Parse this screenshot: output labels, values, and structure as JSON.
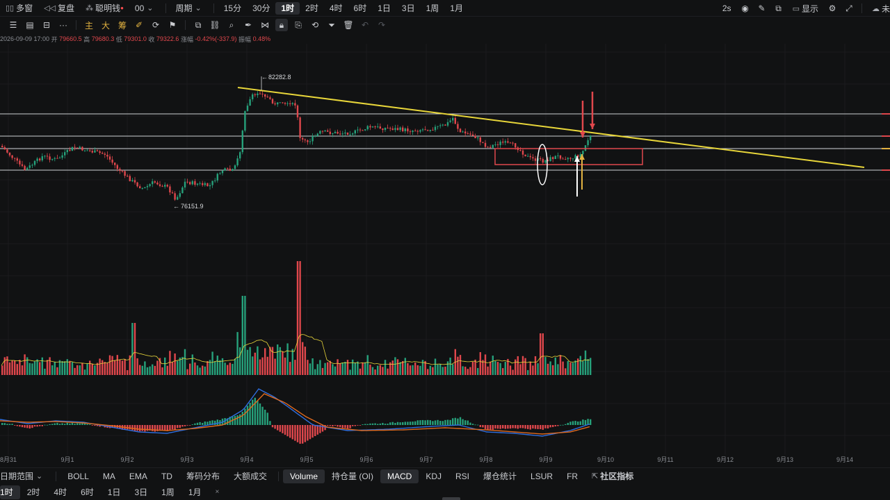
{
  "topbar": {
    "multi_window": "多窗",
    "replay": "复盘",
    "smart_money": "聪明钱",
    "infinity": "00",
    "period": "周期",
    "timeframes": [
      "15分",
      "30分",
      "1时",
      "2时",
      "4时",
      "6时",
      "1日",
      "3日",
      "1周",
      "1月"
    ],
    "active_timeframe": "1时",
    "refresh": "2s",
    "display": "显示",
    "cutoff": "未"
  },
  "drawbar": {
    "main": "主",
    "big": "大",
    "chip": "筹",
    "more": "···"
  },
  "info": {
    "datetime": "2026-09-09 17:00",
    "open_label": "开",
    "open": "79660.5",
    "high_label": "高",
    "high": "79680.3",
    "low_label": "低",
    "low": "79301.0",
    "close_label": "收",
    "close": "79322.6",
    "change_label": "涨幅",
    "change": "-0.42%(-337.9)",
    "amplitude_label": "振幅",
    "amplitude": "0.48%"
  },
  "chart_data": {
    "type": "candlestick",
    "price_high_label": "82282.8",
    "price_low_label": "76151.9",
    "x_ticks": [
      "8月31",
      "9月1",
      "9月2",
      "9月3",
      "9月4",
      "9月5",
      "9月6",
      "9月7",
      "9月8",
      "9月9",
      "9月10",
      "9月11",
      "9月12",
      "9月13",
      "9月14"
    ],
    "colors": {
      "up": "#26a17b",
      "down": "#e0474c",
      "trend": "#e8d63a",
      "zone": "#e0474c",
      "ma": "#e8d63a",
      "dif": "#2f6fe0",
      "dea": "#e06a1e"
    }
  },
  "indicator_bar": {
    "date_range": "日期范围",
    "items": [
      "BOLL",
      "MA",
      "EMA",
      "TD",
      "筹码分布",
      "大额成交"
    ],
    "sub_items": [
      "Volume",
      "持仓量 (OI)",
      "MACD",
      "KDJ",
      "RSI",
      "爆仓统计",
      "LSUR",
      "FR"
    ],
    "active_sub": [
      "Volume",
      "MACD"
    ],
    "community": "社区指标"
  },
  "bottom_timeframes": {
    "items": [
      "1时",
      "2时",
      "4时",
      "6时",
      "1日",
      "3日",
      "1周",
      "1月"
    ],
    "active": "1时",
    "close": "×"
  }
}
